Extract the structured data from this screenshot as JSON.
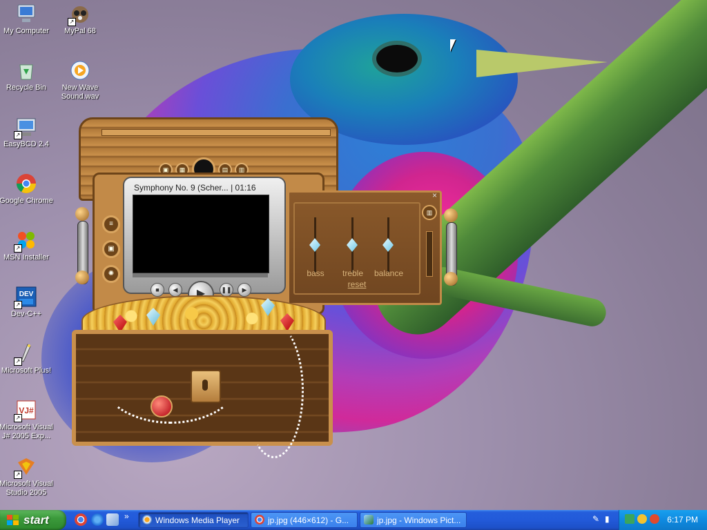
{
  "desktop_icons": [
    {
      "label": "My Computer",
      "icon": "my-computer-icon",
      "shortcut": false
    },
    {
      "label": "MyPal 68",
      "icon": "mypal-icon",
      "shortcut": true
    },
    {
      "label": "Recycle Bin",
      "icon": "recycle-bin-icon",
      "shortcut": false
    },
    {
      "label": "New Wave Sound.wav",
      "icon": "media-file-icon",
      "shortcut": false
    },
    {
      "label": "EasyBCD 2.4",
      "icon": "easybcd-icon",
      "shortcut": true
    },
    {
      "label": "Google Chrome",
      "icon": "chrome-icon",
      "shortcut": false
    },
    {
      "label": "MSN Installer",
      "icon": "msn-icon",
      "shortcut": true
    },
    {
      "label": "Dev-C++",
      "icon": "devcpp-icon",
      "shortcut": true
    },
    {
      "label": "Microsoft Plus!",
      "icon": "microsoft-plus-icon",
      "shortcut": true
    },
    {
      "label": "Microsoft Visual J# 2005 Exp...",
      "icon": "vjsharp-icon",
      "shortcut": true
    },
    {
      "label": "Microsoft Visual Studio 2005",
      "icon": "visual-studio-icon",
      "shortcut": true
    }
  ],
  "player": {
    "now_playing": "Symphony No. 9 (Scher... | 01:16",
    "equalizer": {
      "labels": [
        "bass",
        "treble",
        "balance"
      ],
      "reset": "reset",
      "close": "×"
    }
  },
  "taskbar": {
    "start_label": "start",
    "overflow_chevron": "»",
    "tasks": [
      {
        "label": "Windows Media Player",
        "icon": "wmp-icon",
        "active": true
      },
      {
        "label": "jp.jpg (446×612) - G...",
        "icon": "chrome-icon",
        "active": false
      },
      {
        "label": "jp.jpg - Windows Pict...",
        "icon": "picture-viewer-icon",
        "active": false
      }
    ],
    "clock": "6:17 PM"
  },
  "colors": {
    "taskbar_blue": "#245edc",
    "start_green": "#3c9a3c",
    "tray_blue": "#0f8ae0"
  }
}
